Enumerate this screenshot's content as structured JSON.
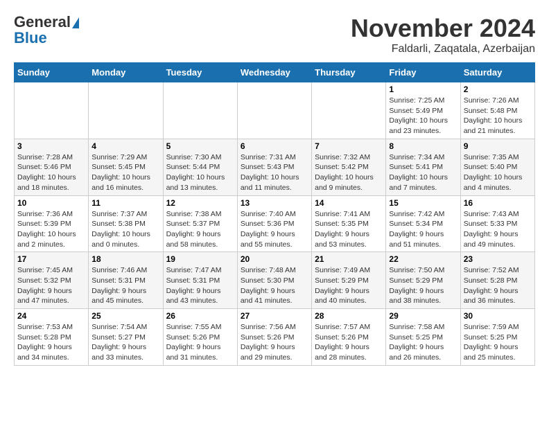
{
  "logo": {
    "line1": "General",
    "line2": "Blue"
  },
  "title": "November 2024",
  "location": "Faldarli, Zaqatala, Azerbaijan",
  "weekdays": [
    "Sunday",
    "Monday",
    "Tuesday",
    "Wednesday",
    "Thursday",
    "Friday",
    "Saturday"
  ],
  "weeks": [
    [
      {
        "day": "",
        "info": ""
      },
      {
        "day": "",
        "info": ""
      },
      {
        "day": "",
        "info": ""
      },
      {
        "day": "",
        "info": ""
      },
      {
        "day": "",
        "info": ""
      },
      {
        "day": "1",
        "info": "Sunrise: 7:25 AM\nSunset: 5:49 PM\nDaylight: 10 hours and 23 minutes."
      },
      {
        "day": "2",
        "info": "Sunrise: 7:26 AM\nSunset: 5:48 PM\nDaylight: 10 hours and 21 minutes."
      }
    ],
    [
      {
        "day": "3",
        "info": "Sunrise: 7:28 AM\nSunset: 5:46 PM\nDaylight: 10 hours and 18 minutes."
      },
      {
        "day": "4",
        "info": "Sunrise: 7:29 AM\nSunset: 5:45 PM\nDaylight: 10 hours and 16 minutes."
      },
      {
        "day": "5",
        "info": "Sunrise: 7:30 AM\nSunset: 5:44 PM\nDaylight: 10 hours and 13 minutes."
      },
      {
        "day": "6",
        "info": "Sunrise: 7:31 AM\nSunset: 5:43 PM\nDaylight: 10 hours and 11 minutes."
      },
      {
        "day": "7",
        "info": "Sunrise: 7:32 AM\nSunset: 5:42 PM\nDaylight: 10 hours and 9 minutes."
      },
      {
        "day": "8",
        "info": "Sunrise: 7:34 AM\nSunset: 5:41 PM\nDaylight: 10 hours and 7 minutes."
      },
      {
        "day": "9",
        "info": "Sunrise: 7:35 AM\nSunset: 5:40 PM\nDaylight: 10 hours and 4 minutes."
      }
    ],
    [
      {
        "day": "10",
        "info": "Sunrise: 7:36 AM\nSunset: 5:39 PM\nDaylight: 10 hours and 2 minutes."
      },
      {
        "day": "11",
        "info": "Sunrise: 7:37 AM\nSunset: 5:38 PM\nDaylight: 10 hours and 0 minutes."
      },
      {
        "day": "12",
        "info": "Sunrise: 7:38 AM\nSunset: 5:37 PM\nDaylight: 9 hours and 58 minutes."
      },
      {
        "day": "13",
        "info": "Sunrise: 7:40 AM\nSunset: 5:36 PM\nDaylight: 9 hours and 55 minutes."
      },
      {
        "day": "14",
        "info": "Sunrise: 7:41 AM\nSunset: 5:35 PM\nDaylight: 9 hours and 53 minutes."
      },
      {
        "day": "15",
        "info": "Sunrise: 7:42 AM\nSunset: 5:34 PM\nDaylight: 9 hours and 51 minutes."
      },
      {
        "day": "16",
        "info": "Sunrise: 7:43 AM\nSunset: 5:33 PM\nDaylight: 9 hours and 49 minutes."
      }
    ],
    [
      {
        "day": "17",
        "info": "Sunrise: 7:45 AM\nSunset: 5:32 PM\nDaylight: 9 hours and 47 minutes."
      },
      {
        "day": "18",
        "info": "Sunrise: 7:46 AM\nSunset: 5:31 PM\nDaylight: 9 hours and 45 minutes."
      },
      {
        "day": "19",
        "info": "Sunrise: 7:47 AM\nSunset: 5:31 PM\nDaylight: 9 hours and 43 minutes."
      },
      {
        "day": "20",
        "info": "Sunrise: 7:48 AM\nSunset: 5:30 PM\nDaylight: 9 hours and 41 minutes."
      },
      {
        "day": "21",
        "info": "Sunrise: 7:49 AM\nSunset: 5:29 PM\nDaylight: 9 hours and 40 minutes."
      },
      {
        "day": "22",
        "info": "Sunrise: 7:50 AM\nSunset: 5:29 PM\nDaylight: 9 hours and 38 minutes."
      },
      {
        "day": "23",
        "info": "Sunrise: 7:52 AM\nSunset: 5:28 PM\nDaylight: 9 hours and 36 minutes."
      }
    ],
    [
      {
        "day": "24",
        "info": "Sunrise: 7:53 AM\nSunset: 5:28 PM\nDaylight: 9 hours and 34 minutes."
      },
      {
        "day": "25",
        "info": "Sunrise: 7:54 AM\nSunset: 5:27 PM\nDaylight: 9 hours and 33 minutes."
      },
      {
        "day": "26",
        "info": "Sunrise: 7:55 AM\nSunset: 5:26 PM\nDaylight: 9 hours and 31 minutes."
      },
      {
        "day": "27",
        "info": "Sunrise: 7:56 AM\nSunset: 5:26 PM\nDaylight: 9 hours and 29 minutes."
      },
      {
        "day": "28",
        "info": "Sunrise: 7:57 AM\nSunset: 5:26 PM\nDaylight: 9 hours and 28 minutes."
      },
      {
        "day": "29",
        "info": "Sunrise: 7:58 AM\nSunset: 5:25 PM\nDaylight: 9 hours and 26 minutes."
      },
      {
        "day": "30",
        "info": "Sunrise: 7:59 AM\nSunset: 5:25 PM\nDaylight: 9 hours and 25 minutes."
      }
    ]
  ]
}
